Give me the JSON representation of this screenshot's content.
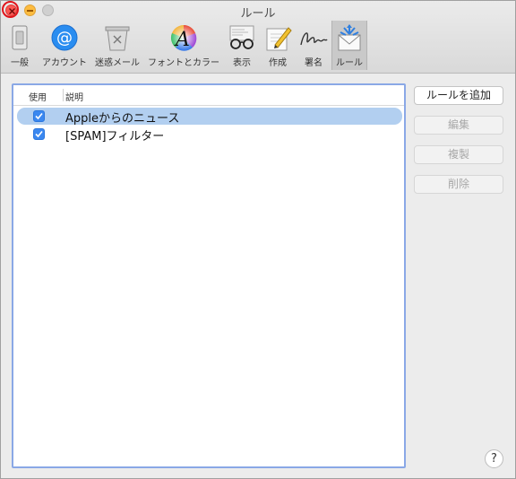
{
  "window": {
    "title": "ルール"
  },
  "toolbar": {
    "items": [
      {
        "label": "一般",
        "icon": "general-switch-icon"
      },
      {
        "label": "アカウント",
        "icon": "at-sign-icon"
      },
      {
        "label": "迷惑メール",
        "icon": "junk-trash-icon"
      },
      {
        "label": "フォントとカラー",
        "icon": "font-color-icon"
      },
      {
        "label": "表示",
        "icon": "glasses-icon"
      },
      {
        "label": "作成",
        "icon": "pencil-paper-icon"
      },
      {
        "label": "署名",
        "icon": "signature-icon"
      },
      {
        "label": "ルール",
        "icon": "rules-envelope-icon"
      }
    ],
    "active_index": 7
  },
  "rules": {
    "header": {
      "use": "使用",
      "description": "説明"
    },
    "rows": [
      {
        "enabled": true,
        "label": "Appleからのニュース",
        "selected": true
      },
      {
        "enabled": true,
        "label": "[SPAM]フィルター",
        "selected": false
      }
    ]
  },
  "buttons": {
    "add": "ルールを追加",
    "edit": "編集",
    "duplicate": "複製",
    "delete": "削除"
  },
  "help": {
    "label": "?"
  },
  "colors": {
    "accent": "#3b88f0",
    "selection": "#b2cff0",
    "focus_ring": "#8aa8e6",
    "close_highlight": "#e0141b"
  }
}
